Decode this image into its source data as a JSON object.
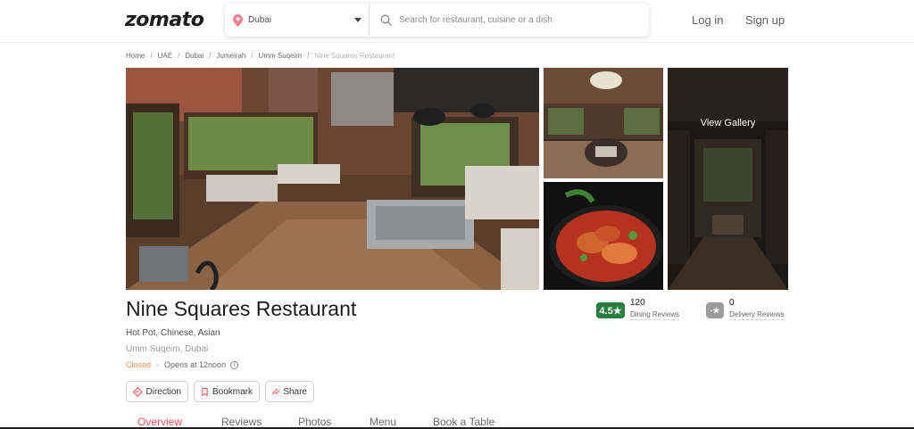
{
  "header": {
    "logo": "zomato",
    "location": "Dubai",
    "search_placeholder": "Search for restaurant, cuisine or a dish",
    "login": "Log in",
    "signup": "Sign up"
  },
  "breadcrumb": [
    "Home",
    "UAE",
    "Dubai",
    "Jumeirah",
    "Umm Suqeim",
    "Nine Squares Restaurant"
  ],
  "gallery": {
    "view_gallery": "View Gallery"
  },
  "restaurant": {
    "name": "Nine Squares Restaurant",
    "cuisine": "Hot Pot, Chinese, Asian",
    "address": "Umm Suqeim, Dubai",
    "status": "Closed",
    "opens": "Opens at 12noon"
  },
  "ratings": {
    "dining": {
      "score": "4.5★",
      "count": "120",
      "label": "Dining Reviews"
    },
    "delivery": {
      "score": "-★",
      "count": "0",
      "label": "Delivery Reviews"
    }
  },
  "actions": {
    "direction": "Direction",
    "bookmark": "Bookmark",
    "share": "Share"
  },
  "tabs": [
    "Overview",
    "Reviews",
    "Photos",
    "Menu",
    "Book a Table"
  ],
  "colors": {
    "brand_red": "#ef4f5f",
    "rating_green": "#267e3e",
    "closed_orange": "#ef8a5b"
  },
  "icons": {
    "location": "location-pin-icon",
    "search": "search-icon",
    "direction": "direction-icon",
    "bookmark": "bookmark-icon",
    "share": "share-icon",
    "info": "info-icon"
  }
}
